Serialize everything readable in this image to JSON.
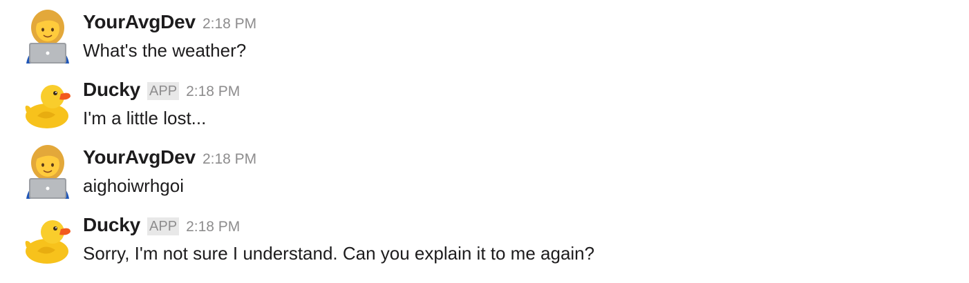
{
  "messages": [
    {
      "author": "YourAvgDev",
      "avatar_icon": "woman-technologist-icon",
      "badge": "",
      "time": "2:18 PM",
      "text": "What's the weather?"
    },
    {
      "author": "Ducky",
      "avatar_icon": "rubber-duck-icon",
      "badge": "APP",
      "time": "2:18 PM",
      "text": "I'm a little lost..."
    },
    {
      "author": "YourAvgDev",
      "avatar_icon": "woman-technologist-icon",
      "badge": "",
      "time": "2:18 PM",
      "text": "aighoiwrhgoi"
    },
    {
      "author": "Ducky",
      "avatar_icon": "rubber-duck-icon",
      "badge": "APP",
      "time": "2:18 PM",
      "text": "Sorry, I'm not sure I understand. Can you explain it to me again?"
    }
  ],
  "colors": {
    "author": "#1d1c1d",
    "timestamp": "#8d8c8d",
    "badge_bg": "#e8e8e8",
    "duck_yellow": "#f7c21c",
    "duck_beak": "#f25a1d"
  }
}
